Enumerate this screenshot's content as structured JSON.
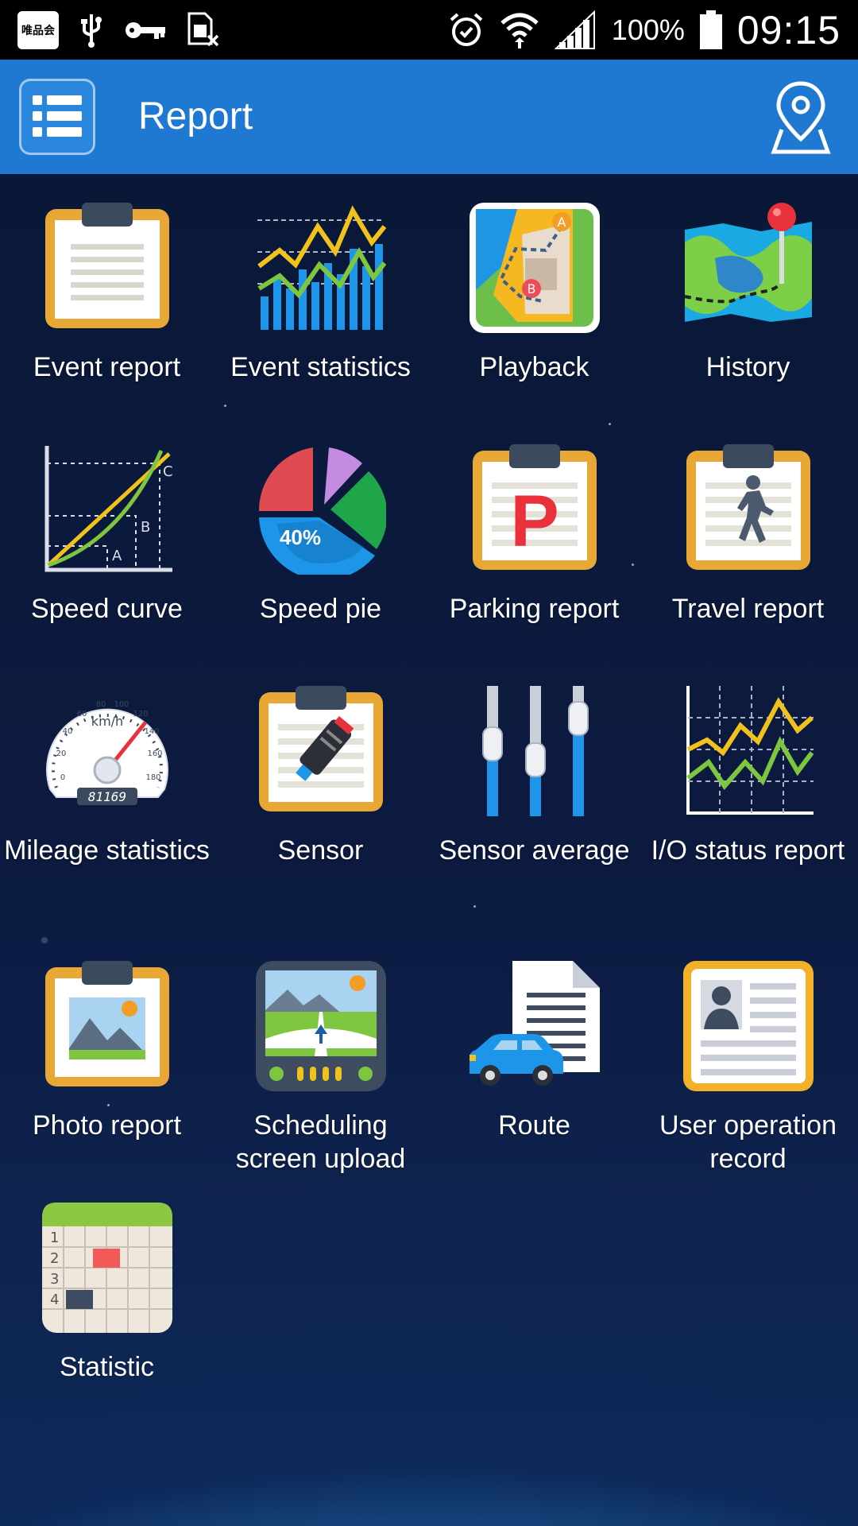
{
  "status_bar": {
    "vip_logo_text": "唯品会",
    "icons": [
      "usb-icon",
      "key-icon",
      "sim-off-icon",
      "alarm-icon",
      "wifi-icon",
      "signal-icon",
      "battery-icon"
    ],
    "battery_percent": "100%",
    "time": "09:15"
  },
  "app_bar": {
    "title": "Report",
    "left_icon": "list-menu-icon",
    "right_icon": "map-pin-icon",
    "color": "#1f78d1"
  },
  "grid": {
    "items": [
      {
        "label": "Event report",
        "icon": "clipboard-icon"
      },
      {
        "label": "Event statistics",
        "icon": "bar-line-chart-icon"
      },
      {
        "label": "Playback",
        "icon": "map-route-icon"
      },
      {
        "label": "History",
        "icon": "map-pin-route-icon"
      },
      {
        "label": "Speed curve",
        "icon": "speed-curve-icon"
      },
      {
        "label": "Speed pie",
        "icon": "pie-chart-icon",
        "icon_text": "40%"
      },
      {
        "label": "Parking report",
        "icon": "parking-clipboard-icon",
        "icon_text": "P"
      },
      {
        "label": "Travel report",
        "icon": "walking-clipboard-icon"
      },
      {
        "label": "Mileage statistics",
        "icon": "speedometer-icon",
        "icon_text": "81169",
        "icon_unit": "km/h"
      },
      {
        "label": "Sensor",
        "icon": "sensor-clipboard-icon"
      },
      {
        "label": "Sensor average",
        "icon": "slider-bars-icon"
      },
      {
        "label": "I/O status report",
        "icon": "io-line-chart-icon"
      },
      {
        "label": "Photo report",
        "icon": "photo-clipboard-icon"
      },
      {
        "label": "Scheduling screen upload",
        "icon": "navigation-screen-icon"
      },
      {
        "label": "Route",
        "icon": "car-document-icon"
      },
      {
        "label": "User operation record",
        "icon": "id-card-icon"
      },
      {
        "label": "Statistic",
        "icon": "calendar-grid-icon"
      }
    ]
  }
}
